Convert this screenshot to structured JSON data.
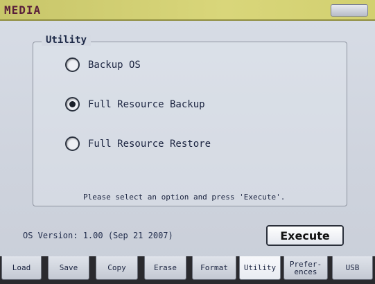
{
  "window": {
    "title": "MEDIA"
  },
  "utility_group": {
    "label": "Utility",
    "options": [
      {
        "label": "Backup OS",
        "selected": false
      },
      {
        "label": "Full Resource Backup",
        "selected": true
      },
      {
        "label": "Full Resource Restore",
        "selected": false
      }
    ],
    "hint": "Please select an option and press 'Execute'."
  },
  "footer": {
    "os_version": "OS Version: 1.00 (Sep 21 2007)",
    "execute_label": "Execute"
  },
  "tabs": [
    {
      "label": "Load",
      "active": false
    },
    {
      "label": "Save",
      "active": false
    },
    {
      "label": "Copy",
      "active": false
    },
    {
      "label": "Erase",
      "active": false
    },
    {
      "label": "Format",
      "active": false
    },
    {
      "label": "Utility",
      "active": true
    },
    {
      "label": "Prefer-\nences",
      "active": false
    },
    {
      "label": "USB",
      "active": false
    }
  ]
}
